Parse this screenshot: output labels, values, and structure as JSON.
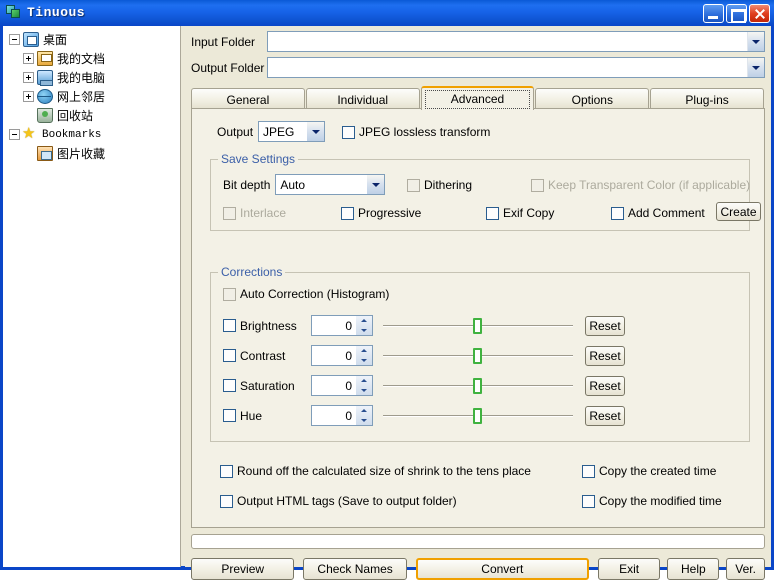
{
  "window": {
    "title": "Tinuous",
    "app_icon": "stacked-layers-icon",
    "controls": {
      "minimize": "minimize-icon",
      "maximize": "maximize-icon",
      "close": "close-icon"
    },
    "accent_color": "#0a46c8",
    "face_color": "#ece9d8"
  },
  "tree": {
    "nodes": [
      {
        "label": "桌面",
        "icon": "desktop-icon",
        "state": "expanded",
        "depth": 0
      },
      {
        "label": "我的文档",
        "icon": "my-documents-icon",
        "state": "collapsed",
        "depth": 1
      },
      {
        "label": "我的电脑",
        "icon": "my-computer-icon",
        "state": "collapsed",
        "depth": 1
      },
      {
        "label": "网上邻居",
        "icon": "network-places-icon",
        "state": "collapsed",
        "depth": 1
      },
      {
        "label": "回收站",
        "icon": "recycle-bin-icon",
        "state": "leaf",
        "depth": 1
      },
      {
        "label": "Bookmarks",
        "icon": "star-icon",
        "state": "expanded",
        "depth": 0
      },
      {
        "label": "图片收藏",
        "icon": "pictures-folder-icon",
        "state": "leaf",
        "depth": 1
      }
    ]
  },
  "folders": {
    "input_label": "Input Folder",
    "input_value": "",
    "output_label": "Output Folder",
    "output_value": ""
  },
  "tabs": {
    "active": "Advanced",
    "items": [
      {
        "label": "General"
      },
      {
        "label": "Individual"
      },
      {
        "label": "Advanced"
      },
      {
        "label": "Options"
      },
      {
        "label": "Plug-ins"
      }
    ]
  },
  "advanced": {
    "output_label": "Output",
    "output_format": "JPEG",
    "jpeg_lossless": {
      "label": "JPEG lossless transform",
      "checked": false,
      "enabled": true
    },
    "save_settings": {
      "legend": "Save Settings",
      "bit_depth_label": "Bit depth",
      "bit_depth_value": "Auto",
      "dithering": {
        "label": "Dithering",
        "checked": false,
        "enabled": true
      },
      "keep_transparent": {
        "label": "Keep Transparent Color (if applicable)",
        "checked": false,
        "enabled": false
      },
      "interlace": {
        "label": "Interlace",
        "checked": false,
        "enabled": false
      },
      "progressive": {
        "label": "Progressive",
        "checked": false,
        "enabled": true
      },
      "exif_copy": {
        "label": "Exif Copy",
        "checked": false,
        "enabled": true
      },
      "add_comment": {
        "label": "Add Comment",
        "checked": false,
        "enabled": true
      },
      "create_button": "Create"
    },
    "corrections": {
      "legend": "Corrections",
      "auto_correction": {
        "label": "Auto Correction (Histogram)",
        "checked": false
      },
      "reset_label": "Reset",
      "sliders": [
        {
          "label": "Brightness",
          "value": "0",
          "checked": false,
          "percent": 50
        },
        {
          "label": "Contrast",
          "value": "0",
          "checked": false,
          "percent": 50
        },
        {
          "label": "Saturation",
          "value": "0",
          "checked": false,
          "percent": 50
        },
        {
          "label": "Hue",
          "value": "0",
          "checked": false,
          "percent": 50
        }
      ]
    },
    "extra_options": {
      "round_off": {
        "label": "Round off the calculated size of shrink to the tens place",
        "checked": false
      },
      "output_html": {
        "label": "Output HTML tags (Save to output folder)",
        "checked": false
      },
      "copy_created": {
        "label": "Copy the created time",
        "checked": false
      },
      "copy_modified": {
        "label": "Copy the modified time",
        "checked": false
      }
    }
  },
  "progress": {
    "percent": 0
  },
  "buttons": {
    "preview": "Preview",
    "check_names": "Check Names",
    "convert": "Convert",
    "exit": "Exit",
    "help": "Help",
    "version": "Ver."
  }
}
